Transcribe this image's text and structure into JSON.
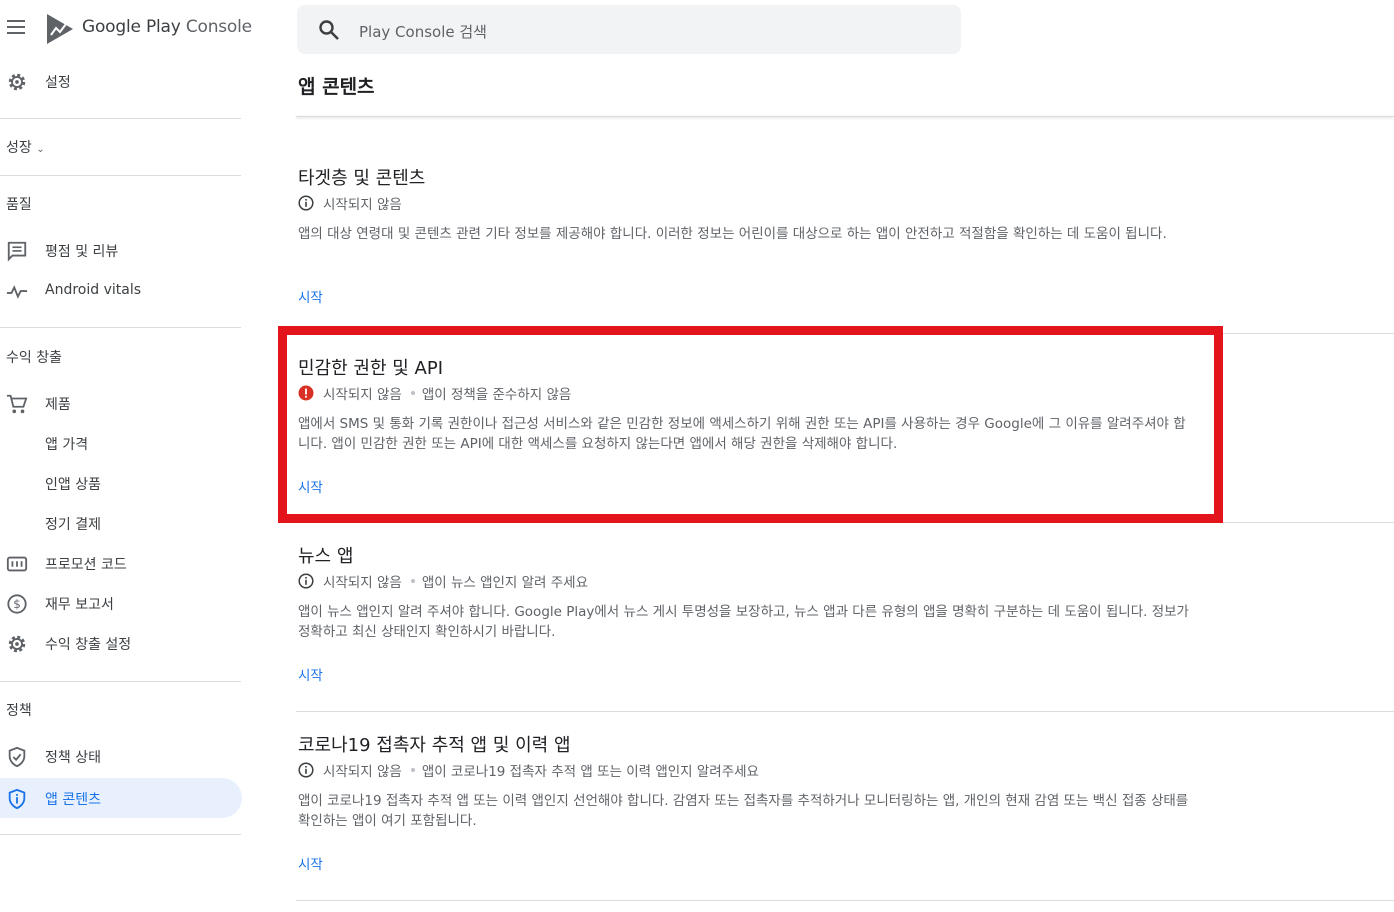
{
  "app": {
    "brand_google": "Google Play",
    "brand_console": "Console"
  },
  "search": {
    "placeholder": "Play Console 검색"
  },
  "page_title": "앱 콘텐츠",
  "sidebar": {
    "settings": "설정",
    "growth": "성장",
    "quality": "품질",
    "ratings_reviews": "평점 및 리뷰",
    "android_vitals": "Android vitals",
    "monetization": "수익 창출",
    "products": "제품",
    "app_pricing": "앱 가격",
    "in_app_products": "인앱 상품",
    "subscriptions": "정기 결제",
    "promo_codes": "프로모션 코드",
    "financial_reports": "재무 보고서",
    "monetization_setup": "수익 창출 설정",
    "policy": "정책",
    "policy_status": "정책 상태",
    "app_content": "앱 콘텐츠"
  },
  "cards": [
    {
      "title": "타겟층 및 콘텐츠",
      "status": "시작되지 않음",
      "status_icon": "info-icon",
      "extra": "",
      "description": "앱의 대상 연령대 및 콘텐츠 관련 기타 정보를 제공해야 합니다. 이러한 정보는 어린이를 대상으로 하는 앱이 안전하고 적절함을 확인하는 데 도움이 됩니다.",
      "action": "시작"
    },
    {
      "title": "민감한 권한 및 API",
      "status": "시작되지 않음",
      "status_icon": "error-icon",
      "extra": "앱이 정책을 준수하지 않음",
      "description": "앱에서 SMS 및 통화 기록 권한이나 접근성 서비스와 같은 민감한 정보에 액세스하기 위해 권한 또는 API를 사용하는 경우 Google에 그 이유를 알려주셔야 합니다. 앱이 민감한 권한 또는 API에 대한 액세스를 요청하지 않는다면 앱에서 해당 권한을 삭제해야 합니다.",
      "action": "시작"
    },
    {
      "title": "뉴스 앱",
      "status": "시작되지 않음",
      "status_icon": "info-icon",
      "extra": "앱이 뉴스 앱인지 알려 주세요",
      "description": "앱이 뉴스 앱인지 알려 주셔야 합니다. Google Play에서 뉴스 게시 투명성을 보장하고, 뉴스 앱과 다른 유형의 앱을 명확히 구분하는 데 도움이 됩니다. 정보가 정확하고 최신 상태인지 확인하시기 바랍니다.",
      "action": "시작"
    },
    {
      "title": "코로나19 접촉자 추적 앱 및 이력 앱",
      "status": "시작되지 않음",
      "status_icon": "info-icon",
      "extra": "앱이 코로나19 접촉자 추적 앱 또는 이력 앱인지 알려주세요",
      "description": "앱이 코로나19 접촉자 추적 앱 또는 이력 앱인지 선언해야 합니다. 감염자 또는 접촉자를 추적하거나 모니터링하는 앱, 개인의 현재 감염 또는 백신 접종 상태를 확인하는 앱이 여기 포함됩니다.",
      "action": "시작"
    }
  ],
  "colors": {
    "accent": "#1a73e8",
    "highlight": "#e3141b",
    "error": "#d93025",
    "active_bg": "#e8f0fe"
  }
}
